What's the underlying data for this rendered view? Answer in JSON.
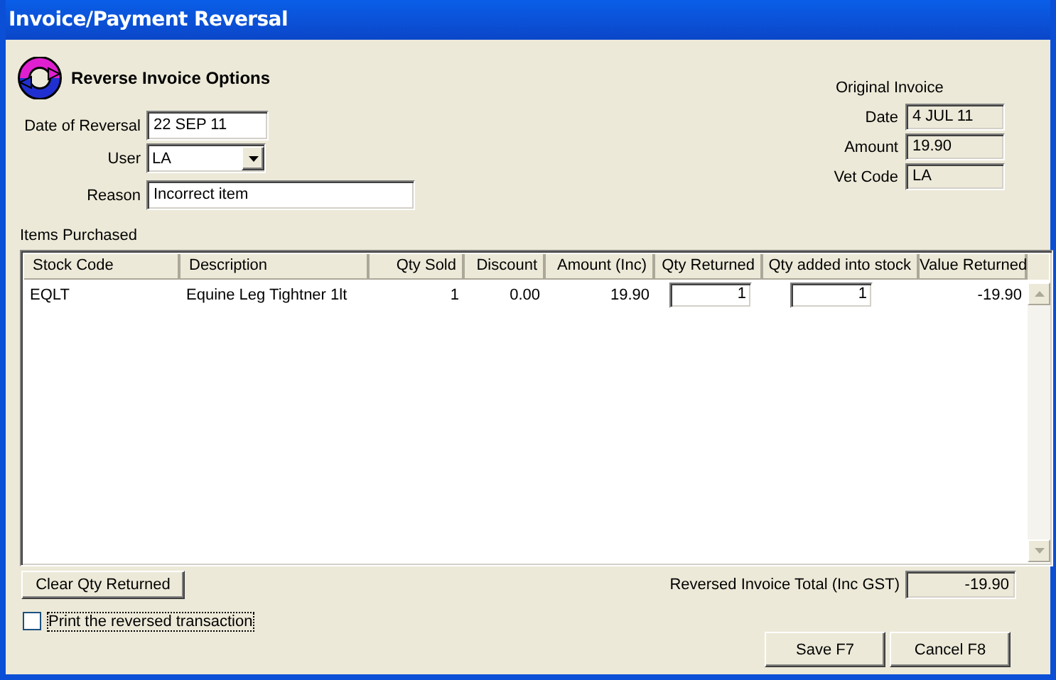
{
  "window": {
    "title": "Invoice/Payment Reversal"
  },
  "header": {
    "title": "Reverse Invoice Options"
  },
  "form": [
    {
      "label": "Date of Reversal",
      "value": "22 SEP 11",
      "kind": "date"
    },
    {
      "label": "User",
      "value": "LA",
      "kind": "combo"
    },
    {
      "label": "Reason",
      "value": "Incorrect item",
      "kind": "text"
    }
  ],
  "original_invoice": {
    "title": "Original Invoice",
    "fields": [
      {
        "label": "Date",
        "value": "4 JUL 11"
      },
      {
        "label": "Amount",
        "value": "19.90"
      },
      {
        "label": "Vet Code",
        "value": "LA"
      }
    ]
  },
  "items": {
    "label": "Items Purchased",
    "columns": [
      "Stock Code",
      "Description",
      "Qty Sold",
      "Discount",
      "Amount (Inc)",
      "Qty Returned",
      "Qty added into stock",
      "Value Returned"
    ],
    "rows": [
      {
        "stock_code": "EQLT",
        "description": "Equine Leg Tightner 1lt",
        "qty_sold": "1",
        "discount": "0.00",
        "amount": "19.90",
        "qty_returned": "1",
        "qty_added": "1",
        "value_returned": "-19.90"
      }
    ]
  },
  "clear_button": "Clear Qty Returned",
  "total": {
    "label": "Reversed Invoice Total (Inc GST)",
    "value": "-19.90"
  },
  "print_checkbox": {
    "label": "Print the reversed transaction",
    "checked": false
  },
  "buttons": [
    "Save F7",
    "Cancel F8"
  ]
}
